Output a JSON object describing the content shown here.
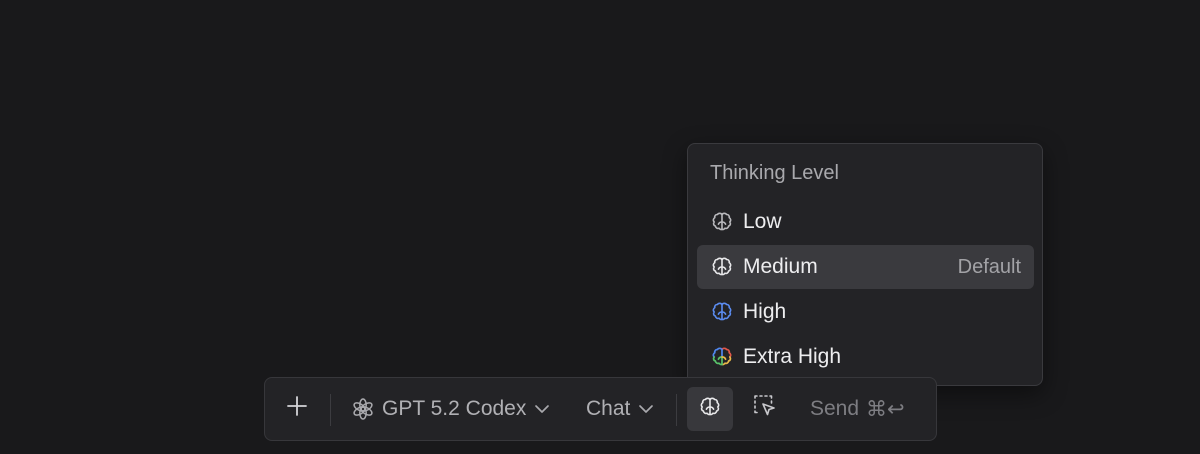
{
  "thinking_menu": {
    "title": "Thinking Level",
    "items": [
      {
        "label": "Low",
        "badge": "",
        "icon": "brain-outline-icon",
        "icon_color": "#b9b9bd"
      },
      {
        "label": "Medium",
        "badge": "Default",
        "icon": "brain-outline-icon",
        "icon_color": "#e8e8ea",
        "selected": true
      },
      {
        "label": "High",
        "badge": "",
        "icon": "brain-outline-icon",
        "icon_color": "#5b8cf0"
      },
      {
        "label": "Extra High",
        "badge": "",
        "icon": "brain-multicolor-icon",
        "icon_colors": [
          "#4f86ef",
          "#e0564b",
          "#e9b949",
          "#58c26a"
        ]
      }
    ]
  },
  "toolbar": {
    "add_icon": "plus-icon",
    "model_label": "GPT 5.2 Codex",
    "model_icon": "openai-logo-icon",
    "mode_label": "Chat",
    "thinking_icon": "brain-icon",
    "select_icon": "selection-cursor-icon",
    "send_label": "Send",
    "send_shortcut": "⌘↩"
  },
  "colors": {
    "background": "#19191b",
    "panel": "#232326",
    "selected_row": "#3a3a3e",
    "text_primary": "#ededef",
    "text_secondary": "#a9a9ad"
  }
}
